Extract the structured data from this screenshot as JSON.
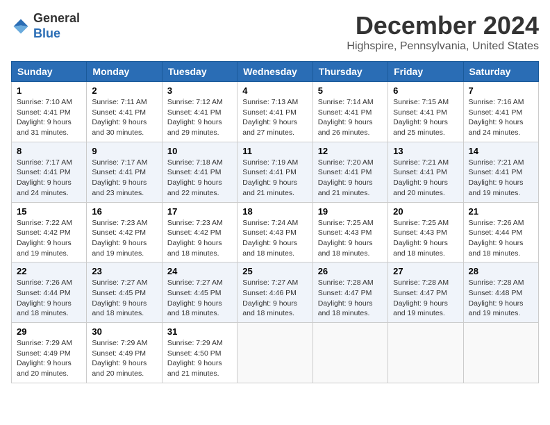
{
  "logo": {
    "general": "General",
    "blue": "Blue"
  },
  "title": "December 2024",
  "location": "Highspire, Pennsylvania, United States",
  "weekdays": [
    "Sunday",
    "Monday",
    "Tuesday",
    "Wednesday",
    "Thursday",
    "Friday",
    "Saturday"
  ],
  "weeks": [
    [
      {
        "day": "1",
        "sunrise": "7:10 AM",
        "sunset": "4:41 PM",
        "daylight": "9 hours and 31 minutes."
      },
      {
        "day": "2",
        "sunrise": "7:11 AM",
        "sunset": "4:41 PM",
        "daylight": "9 hours and 30 minutes."
      },
      {
        "day": "3",
        "sunrise": "7:12 AM",
        "sunset": "4:41 PM",
        "daylight": "9 hours and 29 minutes."
      },
      {
        "day": "4",
        "sunrise": "7:13 AM",
        "sunset": "4:41 PM",
        "daylight": "9 hours and 27 minutes."
      },
      {
        "day": "5",
        "sunrise": "7:14 AM",
        "sunset": "4:41 PM",
        "daylight": "9 hours and 26 minutes."
      },
      {
        "day": "6",
        "sunrise": "7:15 AM",
        "sunset": "4:41 PM",
        "daylight": "9 hours and 25 minutes."
      },
      {
        "day": "7",
        "sunrise": "7:16 AM",
        "sunset": "4:41 PM",
        "daylight": "9 hours and 24 minutes."
      }
    ],
    [
      {
        "day": "8",
        "sunrise": "7:17 AM",
        "sunset": "4:41 PM",
        "daylight": "9 hours and 24 minutes."
      },
      {
        "day": "9",
        "sunrise": "7:17 AM",
        "sunset": "4:41 PM",
        "daylight": "9 hours and 23 minutes."
      },
      {
        "day": "10",
        "sunrise": "7:18 AM",
        "sunset": "4:41 PM",
        "daylight": "9 hours and 22 minutes."
      },
      {
        "day": "11",
        "sunrise": "7:19 AM",
        "sunset": "4:41 PM",
        "daylight": "9 hours and 21 minutes."
      },
      {
        "day": "12",
        "sunrise": "7:20 AM",
        "sunset": "4:41 PM",
        "daylight": "9 hours and 21 minutes."
      },
      {
        "day": "13",
        "sunrise": "7:21 AM",
        "sunset": "4:41 PM",
        "daylight": "9 hours and 20 minutes."
      },
      {
        "day": "14",
        "sunrise": "7:21 AM",
        "sunset": "4:41 PM",
        "daylight": "9 hours and 19 minutes."
      }
    ],
    [
      {
        "day": "15",
        "sunrise": "7:22 AM",
        "sunset": "4:42 PM",
        "daylight": "9 hours and 19 minutes."
      },
      {
        "day": "16",
        "sunrise": "7:23 AM",
        "sunset": "4:42 PM",
        "daylight": "9 hours and 19 minutes."
      },
      {
        "day": "17",
        "sunrise": "7:23 AM",
        "sunset": "4:42 PM",
        "daylight": "9 hours and 18 minutes."
      },
      {
        "day": "18",
        "sunrise": "7:24 AM",
        "sunset": "4:43 PM",
        "daylight": "9 hours and 18 minutes."
      },
      {
        "day": "19",
        "sunrise": "7:25 AM",
        "sunset": "4:43 PM",
        "daylight": "9 hours and 18 minutes."
      },
      {
        "day": "20",
        "sunrise": "7:25 AM",
        "sunset": "4:43 PM",
        "daylight": "9 hours and 18 minutes."
      },
      {
        "day": "21",
        "sunrise": "7:26 AM",
        "sunset": "4:44 PM",
        "daylight": "9 hours and 18 minutes."
      }
    ],
    [
      {
        "day": "22",
        "sunrise": "7:26 AM",
        "sunset": "4:44 PM",
        "daylight": "9 hours and 18 minutes."
      },
      {
        "day": "23",
        "sunrise": "7:27 AM",
        "sunset": "4:45 PM",
        "daylight": "9 hours and 18 minutes."
      },
      {
        "day": "24",
        "sunrise": "7:27 AM",
        "sunset": "4:45 PM",
        "daylight": "9 hours and 18 minutes."
      },
      {
        "day": "25",
        "sunrise": "7:27 AM",
        "sunset": "4:46 PM",
        "daylight": "9 hours and 18 minutes."
      },
      {
        "day": "26",
        "sunrise": "7:28 AM",
        "sunset": "4:47 PM",
        "daylight": "9 hours and 18 minutes."
      },
      {
        "day": "27",
        "sunrise": "7:28 AM",
        "sunset": "4:47 PM",
        "daylight": "9 hours and 19 minutes."
      },
      {
        "day": "28",
        "sunrise": "7:28 AM",
        "sunset": "4:48 PM",
        "daylight": "9 hours and 19 minutes."
      }
    ],
    [
      {
        "day": "29",
        "sunrise": "7:29 AM",
        "sunset": "4:49 PM",
        "daylight": "9 hours and 20 minutes."
      },
      {
        "day": "30",
        "sunrise": "7:29 AM",
        "sunset": "4:49 PM",
        "daylight": "9 hours and 20 minutes."
      },
      {
        "day": "31",
        "sunrise": "7:29 AM",
        "sunset": "4:50 PM",
        "daylight": "9 hours and 21 minutes."
      },
      null,
      null,
      null,
      null
    ]
  ]
}
